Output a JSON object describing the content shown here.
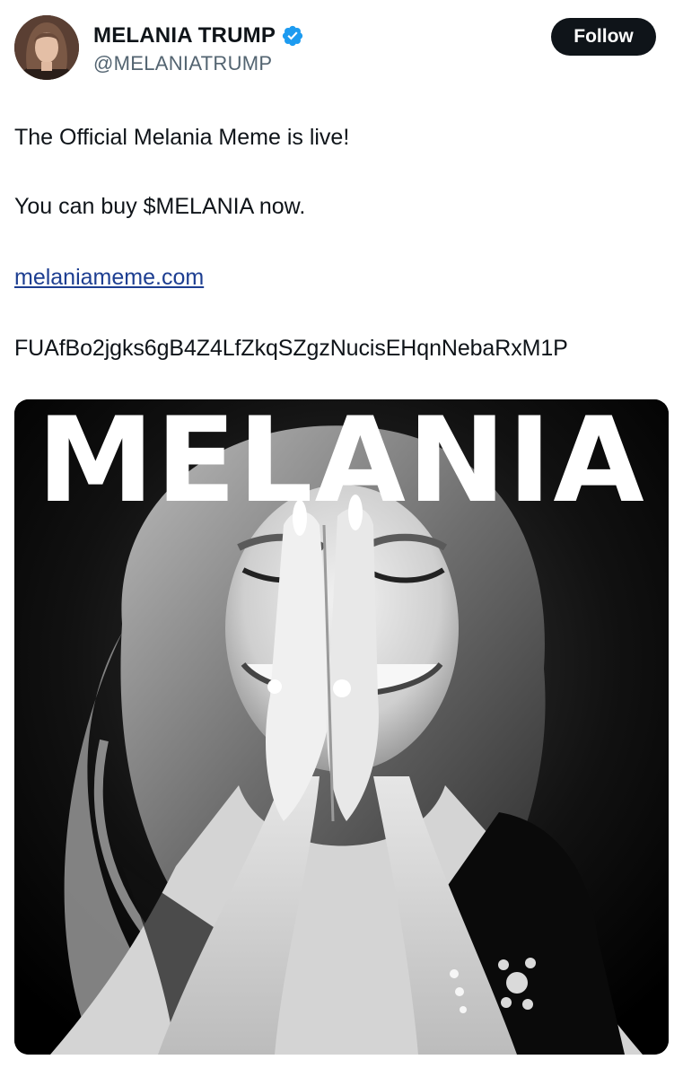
{
  "author": {
    "display_name": "MELANIA TRUMP",
    "handle": "@MELANIATRUMP",
    "verified_icon": "verified-badge-icon",
    "badge_color": "#1d9bf0"
  },
  "follow_button": {
    "label": "Follow"
  },
  "tweet": {
    "line1": "The Official Melania Meme is live!",
    "line2": "You can buy $MELANIA now.",
    "link": "melaniameme.com",
    "contract": "FUAfBo2jgks6gB4Z4LfZkqSZgzNucisEHqnNebaRxM1P"
  },
  "media": {
    "title": "MELANIA"
  }
}
